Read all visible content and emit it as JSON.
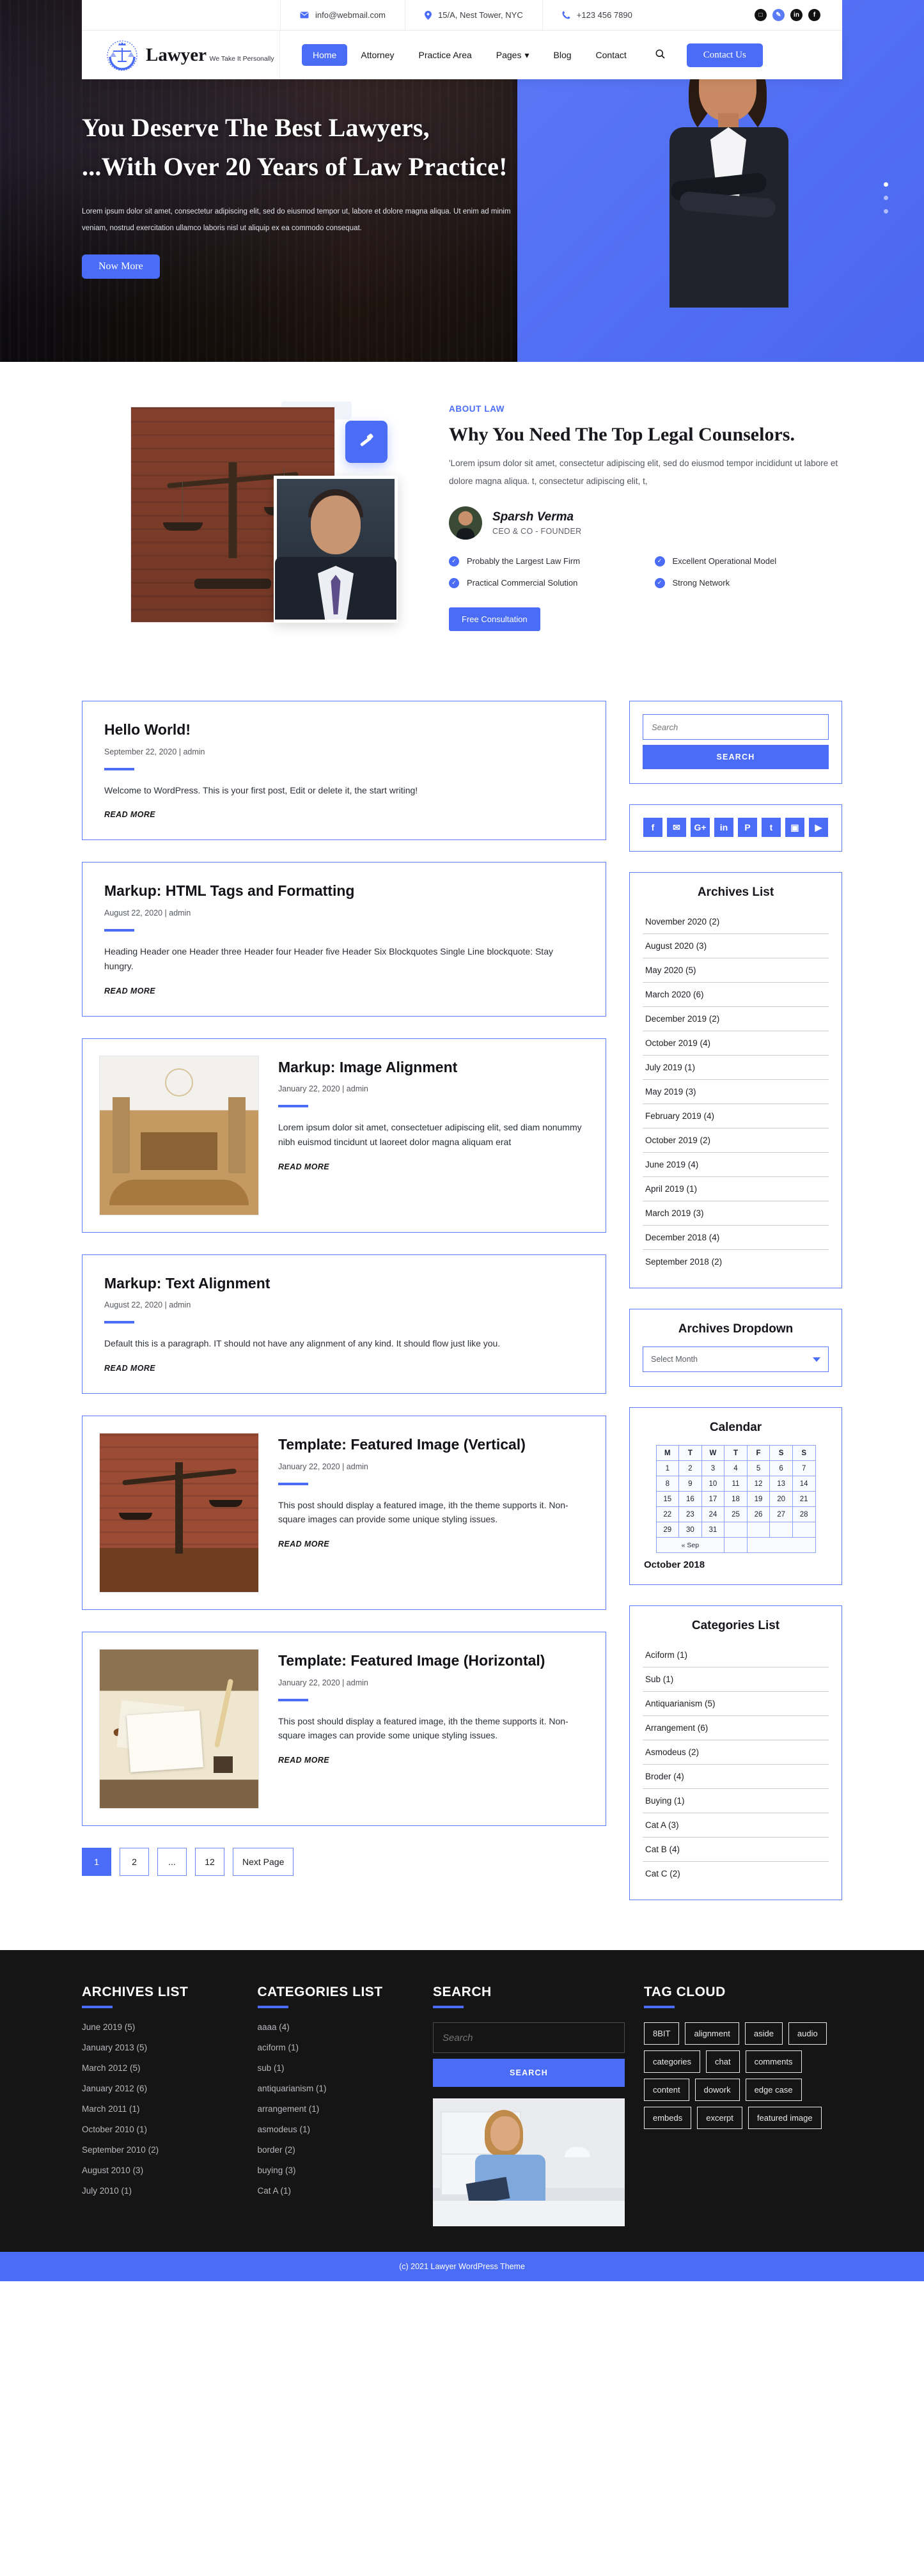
{
  "topbar": {
    "email": "info@webmail.com",
    "address": "15/A, Nest Tower, NYC",
    "phone": "+123 456 7890",
    "social": [
      {
        "name": "instagram-icon",
        "glyph": "▣"
      },
      {
        "name": "twitter-icon",
        "glyph": "✉"
      },
      {
        "name": "linkedin-icon",
        "glyph": "in"
      },
      {
        "name": "facebook-icon",
        "glyph": "f"
      }
    ]
  },
  "brand": {
    "name": "Lawyer",
    "tagline": "We Take It Personally"
  },
  "nav": {
    "items": [
      {
        "label": "Home",
        "active": true
      },
      {
        "label": "Attorney",
        "active": false
      },
      {
        "label": "Practice Area",
        "active": false
      },
      {
        "label": "Pages",
        "active": false,
        "caret": true
      },
      {
        "label": "Blog",
        "active": false
      },
      {
        "label": "Contact",
        "active": false
      }
    ],
    "search_icon": "search-icon",
    "cta": "Contact Us"
  },
  "hero": {
    "line1": "You Deserve The Best Lawyers,",
    "line2": "...With Over 20 Years of Law Practice!",
    "paragraph": "Lorem ipsum dolor sit amet, consectetur adipiscing elit, sed do eiusmod tempor ut, labore et dolore magna aliqua. Ut enim ad minim veniam, nostrud exercitation  ullamco laboris nisl ut aliquip ex ea commodo consequat.",
    "button": "Now More",
    "slider_dots": 3,
    "active_dot": 0
  },
  "about": {
    "kicker": "ABOUT LAW",
    "title": "Why You Need The Top Legal Counselors.",
    "text": "'Lorem ipsum dolor sit amet, consectetur adipiscing elit, sed do eiusmod tempor incididunt ut labore et dolore magna aliqua. t, consectetur adipiscing elit, t,",
    "person_name": "Sparsh Verma",
    "person_role": "CEO & CO - FOUNDER",
    "features": [
      "Probably the Largest Law Firm",
      "Excellent Operational Model",
      "Practical Commercial Solution",
      "Strong Network"
    ],
    "button": "Free Consultation"
  },
  "posts": [
    {
      "title": "Hello World!",
      "meta": "September 22, 2020 | admin",
      "text": "Welcome to WordPress. This is your first post, Edit or delete it, the start writing!",
      "read_more": "READ MORE",
      "has_image": false
    },
    {
      "title": "Markup: HTML Tags and Formatting",
      "meta": "August 22, 2020 | admin",
      "text": "Heading Header one Header three Header four Header five Header Six Blockquotes Single Line blockquote: Stay hungry.",
      "read_more": "READ MORE",
      "has_image": false
    },
    {
      "title": "Markup: Image Alignment",
      "meta": "January 22, 2020 | admin",
      "text": "Lorem ipsum dolor sit amet, consectetuer adipiscing elit, sed diam nonummy nibh euismod tincidunt ut laoreet dolor magna aliquam erat",
      "read_more": "READ MORE",
      "has_image": true,
      "image_name": "courtroom-interior-photo"
    },
    {
      "title": "Markup: Text Alignment",
      "meta": "August 22, 2020 | admin",
      "text": "Default this is a paragraph. IT should not have any alignment of any kind. It should flow just like you.",
      "read_more": "READ MORE",
      "has_image": false
    },
    {
      "title": "Template: Featured Image (Vertical)",
      "meta": "January 22, 2020 | admin",
      "text": "This post should display a featured image, ith the theme supports it. Non-square images can provide some unique styling issues.",
      "read_more": "READ MORE",
      "has_image": true,
      "image_name": "justice-scales-photo"
    },
    {
      "title": "Template: Featured Image (Horizontal)",
      "meta": "January 22, 2020 | admin",
      "text": "This post should display a featured image, ith the theme supports it. Non-square images can provide some unique styling issues.",
      "read_more": "READ MORE",
      "has_image": true,
      "image_name": "quill-documents-photo"
    }
  ],
  "pagination": [
    {
      "label": "1",
      "active": true
    },
    {
      "label": "2",
      "active": false
    },
    {
      "label": "...",
      "active": false
    },
    {
      "label": "12",
      "active": false
    },
    {
      "label": "Next Page",
      "active": false
    }
  ],
  "sidebar": {
    "search_placeholder": "Search",
    "search_button": "SEARCH",
    "social": [
      {
        "name": "facebook-icon",
        "glyph": "f"
      },
      {
        "name": "twitter-icon",
        "glyph": "✉"
      },
      {
        "name": "google-plus-icon",
        "glyph": "G+"
      },
      {
        "name": "linkedin-icon",
        "glyph": "in"
      },
      {
        "name": "pinterest-icon",
        "glyph": "P"
      },
      {
        "name": "tumblr-icon",
        "glyph": "t"
      },
      {
        "name": "instagram-icon",
        "glyph": "▣"
      },
      {
        "name": "youtube-icon",
        "glyph": "▶"
      }
    ],
    "archives_title": "Archives List",
    "archives": [
      "November 2020 (2)",
      "August 2020 (3)",
      "May 2020 (5)",
      "March 2020 (6)",
      "December 2019 (2)",
      "October 2019 (4)",
      "July 2019 (1)",
      "May 2019 (3)",
      "February 2019 (4)",
      "October 2019 (2)",
      "June 2019 (4)",
      "April 2019 (1)",
      "March 2019 (3)",
      "December 2018 (4)",
      "September 2018 (2)"
    ],
    "dropdown_title": "Archives Dropdown",
    "dropdown_value": "Select Month",
    "calendar_title": "Calendar",
    "calendar": {
      "weekdays": [
        "M",
        "T",
        "W",
        "T",
        "F",
        "S",
        "S"
      ],
      "weeks": [
        [
          "1",
          "2",
          "3",
          "4",
          "5",
          "6",
          "7"
        ],
        [
          "8",
          "9",
          "10",
          "11",
          "12",
          "13",
          "14"
        ],
        [
          "15",
          "16",
          "17",
          "18",
          "19",
          "20",
          "21"
        ],
        [
          "22",
          "23",
          "24",
          "25",
          "26",
          "27",
          "28"
        ],
        [
          "29",
          "30",
          "31",
          "",
          "",
          "",
          ""
        ]
      ],
      "prev_label": "« Sep",
      "caption": "October 2018"
    },
    "categories_title": "Categories List",
    "categories": [
      "Aciform (1)",
      "Sub (1)",
      "Antiquarianism (5)",
      "Arrangement (6)",
      "Asmodeus (2)",
      "Broder (4)",
      "Buying (1)",
      "Cat A (3)",
      "Cat B (4)",
      "Cat C (2)"
    ]
  },
  "footer": {
    "archives_title": "ARCHIVES LIST",
    "archives": [
      "June 2019 (5)",
      "January  2013 (5)",
      "March 2012 (5)",
      "January  2012 (6)",
      "March  2011 (1)",
      "October 2010 (1)",
      "September 2010 (2)",
      "August 2010 (3)",
      "July 2010 (1)"
    ],
    "categories_title": "CATEGORIES LIST",
    "categories": [
      "aaaa (4)",
      "aciform (1)",
      "sub (1)",
      "antiquarianism (1)",
      "arrangement (1)",
      "asmodeus (1)",
      "border (2)",
      "buying (3)",
      "Cat A (1)"
    ],
    "search_title": "SEARCH",
    "search_placeholder": "Search",
    "search_button": "SEARCH",
    "image_name": "businesswoman-office-photo",
    "tag_title": "TAG CLOUD",
    "tags": [
      "8BIT",
      "alignment",
      "aside",
      "audio",
      "categories",
      "chat",
      "comments",
      "content",
      "dowork",
      "edge case",
      "embeds",
      "excerpt",
      "featured image"
    ],
    "copyright": "(c) 2021 Lawyer WordPress Theme"
  },
  "colors": {
    "accent": "#4a6cf7",
    "footer_bg": "#151515",
    "border": "#5a7bf7"
  }
}
